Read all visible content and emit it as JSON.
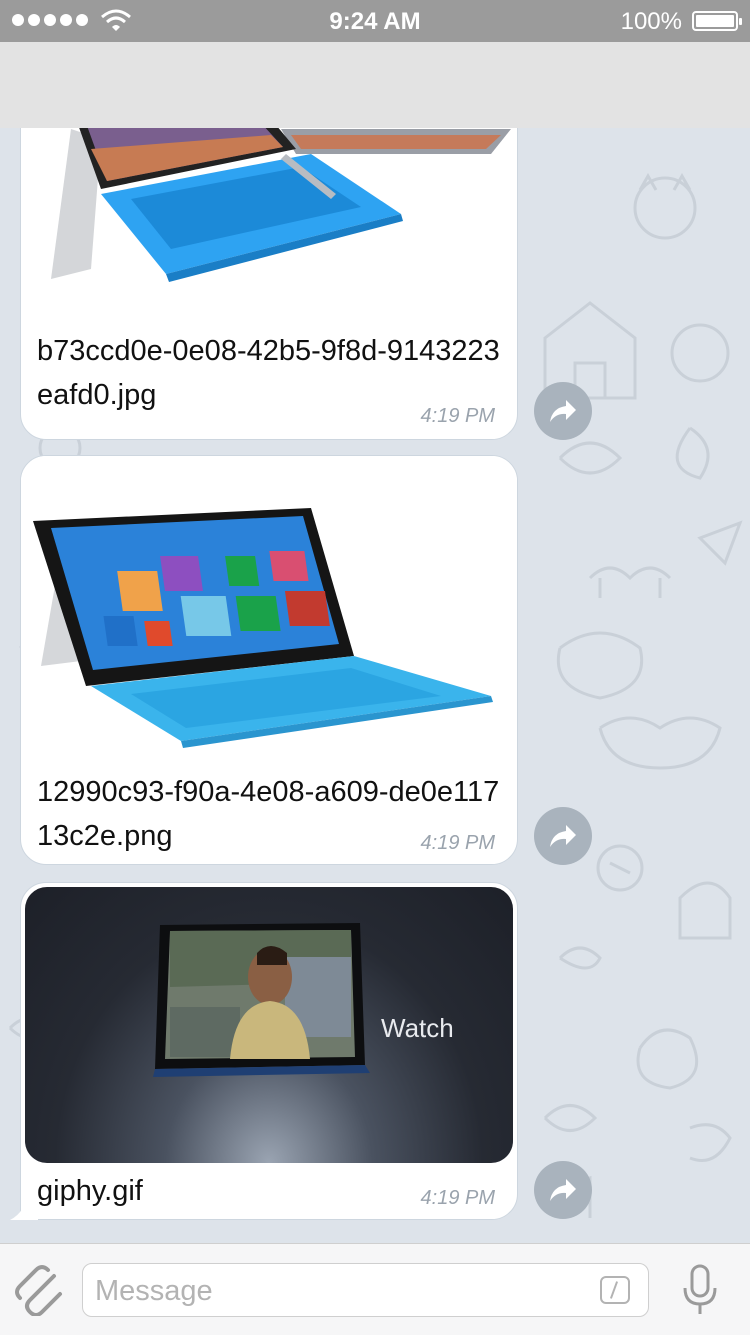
{
  "status_bar": {
    "time": "9:24 AM",
    "battery": "100%"
  },
  "messages": [
    {
      "filename": "b73ccd0e-0e08-42b5-9f8d-9143223eafd0.jpg",
      "time": "4:19 PM"
    },
    {
      "filename": "12990c93-f90a-4e08-a609-de0e11713c2e.png",
      "time": "4:19 PM"
    },
    {
      "filename": "giphy.gif",
      "time": "4:19 PM",
      "overlay_text": "Watch"
    }
  ],
  "input": {
    "placeholder": "Message"
  },
  "colors": {
    "accent": "#a9b3bd",
    "background": "#dde3ea",
    "surface_blue": "#2ea3f2"
  }
}
